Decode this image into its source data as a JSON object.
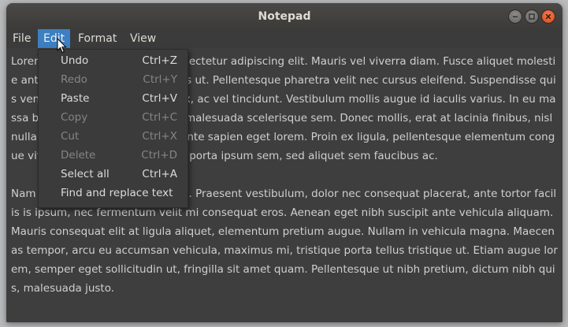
{
  "window": {
    "title": "Notepad"
  },
  "menubar": {
    "items": [
      {
        "label": "File"
      },
      {
        "label": "Edit"
      },
      {
        "label": "Format"
      },
      {
        "label": "View"
      }
    ]
  },
  "edit_menu": {
    "items": [
      {
        "label": "Undo",
        "shortcut": "Ctrl+Z",
        "enabled": true
      },
      {
        "label": "Redo",
        "shortcut": "Ctrl+Y",
        "enabled": false
      },
      {
        "label": "Paste",
        "shortcut": "Ctrl+V",
        "enabled": true
      },
      {
        "label": "Copy",
        "shortcut": "Ctrl+C",
        "enabled": false
      },
      {
        "label": "Cut",
        "shortcut": "Ctrl+X",
        "enabled": false
      },
      {
        "label": "Delete",
        "shortcut": "Ctrl+D",
        "enabled": false
      },
      {
        "label": "Select all",
        "shortcut": "Ctrl+A",
        "enabled": true
      },
      {
        "label": "Find and replace text",
        "shortcut": "",
        "enabled": true
      }
    ]
  },
  "editor": {
    "content": "Lorem ipsum dolor sit amet, consectetur adipiscing elit. Mauris vel viverra diam. Fusce aliquet molestie ante, sit amet tempor ex cursus ut. Pellentesque pharetra velit nec cursus eleifend. Suspendisse quis venenatis est, eu fermentum ex, ac vel tincidunt. Vestibulum mollis augue id iaculis varius. In eu massa bibendum, lacinia justo sed, malesuada scelerisque sem. Donec mollis, erat at lacinia finibus, nisl nulla dapibus orci, ut vulputate ante sapien eget lorem. Proin ex ligula, pellentesque elementum congue vitae, eleifend ac nunc. Fusce porta ipsum sem, sed aliquet sem faucibus ac.\n\nNam sit amet sem ac ex faucibus. Praesent vestibulum, dolor nec consequat placerat, ante tortor facilis is ipsum, nec fermentum velit mi consequat eros. Aenean eget nibh suscipit ante vehicula aliquam. Mauris consequat elit at ligula aliquet, elementum pretium augue. Nullam in vehicula magna. Maecenas tempor, arcu eu accumsan vehicula, maximus mi, tristique porta tellus tristique ut. Etiam augue lorem, semper eget sollicitudin ut, fringilla sit amet quam. Pellentesque ut nibh pretium, dictum nibh quis, malesuada justo."
  },
  "colors": {
    "accent": "#3c7fc2",
    "close_button": "#e2572a"
  }
}
